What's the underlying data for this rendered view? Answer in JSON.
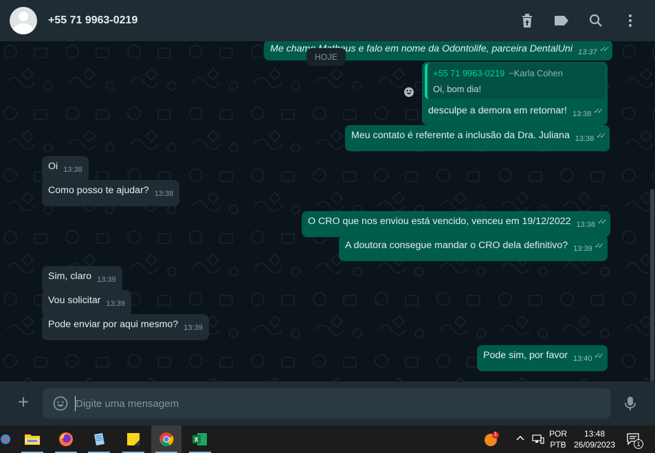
{
  "header": {
    "contact_name": "+55 71 9963-0219",
    "icons": [
      "delete-icon",
      "label-icon",
      "search-icon",
      "menu-icon"
    ]
  },
  "chat": {
    "date_separator": "HOJE",
    "messages": [
      {
        "dir": "out",
        "text": "Me chamo Matheus e falo em nome da Odontolife, parceira DentalUni",
        "time": "13:37",
        "status": "read"
      },
      {
        "dir": "out",
        "quote_from": "+55 71 9963-0219",
        "quote_alias": "~Karla Cohen",
        "quote_text": "Oi, bom dia!",
        "text": "desculpe a demora em retornar!",
        "time": "13:38",
        "status": "read"
      },
      {
        "dir": "out",
        "text": "Meu contato é referente a inclusão da Dra. Juliana",
        "time": "13:38",
        "status": "read"
      },
      {
        "dir": "in",
        "text": "Oi",
        "time": "13:38"
      },
      {
        "dir": "in",
        "text": "Como posso te ajudar?",
        "time": "13:38"
      },
      {
        "dir": "out",
        "text": "O CRO que nos enviou está vencido, venceu em 19/12/2022",
        "time": "13:38",
        "status": "read"
      },
      {
        "dir": "out",
        "text": "A doutora consegue mandar o CRO dela definitivo?",
        "time": "13:39",
        "status": "read"
      },
      {
        "dir": "in",
        "text": "Sim, claro",
        "time": "13:39"
      },
      {
        "dir": "in",
        "text": "Vou solicitar",
        "time": "13:39"
      },
      {
        "dir": "in",
        "text": "Pode enviar por aqui mesmo?",
        "time": "13:39"
      },
      {
        "dir": "out",
        "text": "Pode sim, por favor",
        "time": "13:40",
        "status": "read"
      }
    ]
  },
  "compose": {
    "placeholder": "Digite uma mensagem"
  },
  "taskbar": {
    "apps": [
      "app-icon",
      "file-explorer-icon",
      "firefox-icon",
      "notepad-icon",
      "sticky-notes-icon",
      "chrome-icon",
      "excel-icon"
    ],
    "tray": {
      "notification_badge": "1",
      "lang_line1": "POR",
      "lang_line2": "PTB",
      "time": "13:48",
      "date": "26/09/2023",
      "action_center_badge": "1"
    }
  },
  "colors": {
    "outgoing_bubble": "#005c4b",
    "incoming_bubble": "#202c33",
    "background": "#0b141a",
    "accent": "#06cf9c"
  }
}
